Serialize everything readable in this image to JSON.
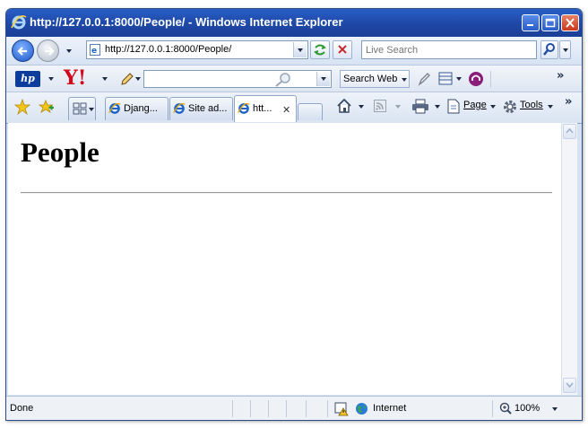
{
  "window": {
    "title": "http://127.0.0.1:8000/People/ - Windows Internet Explorer"
  },
  "address_bar": {
    "url": "http://127.0.0.1:8000/People/"
  },
  "search_box": {
    "placeholder": "Live Search"
  },
  "yahoo_toolbar": {
    "brand": "Y!",
    "search_button": "Search Web"
  },
  "tabs": [
    {
      "label": "Djang..."
    },
    {
      "label": "Site ad..."
    },
    {
      "label": "htt..."
    }
  ],
  "command_bar": {
    "page_label": "Page",
    "tools_label": "Tools"
  },
  "page": {
    "heading": "People"
  },
  "status_bar": {
    "status": "Done",
    "zone": "Internet",
    "zoom": "100%"
  },
  "colors": {
    "titlebar": "#1e48a6",
    "yahoo_red": "#d2091c",
    "hp_blue": "#0c3c9c"
  }
}
